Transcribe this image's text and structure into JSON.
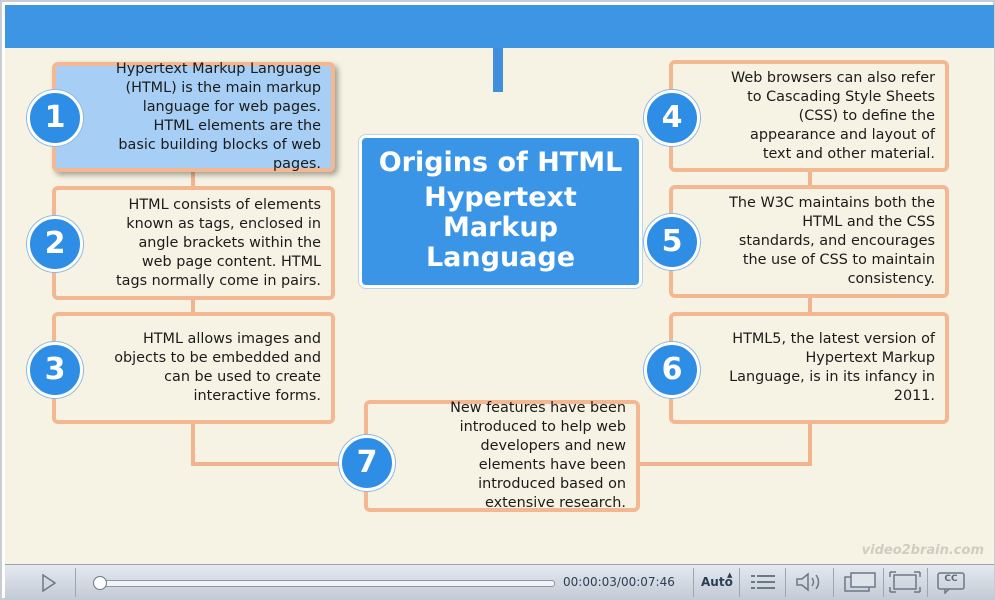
{
  "slide": {
    "center_title_line1": "Origins of HTML",
    "center_title_line2": "Hypertext\nMarkup\nLanguage",
    "watermark": "video2brain.com",
    "items": [
      {
        "number": "1",
        "text": "Hypertext Markup Language (HTML) is the main markup language for web pages. HTML elements are the basic building blocks of web pages.",
        "highlighted": true
      },
      {
        "number": "2",
        "text": "HTML consists of elements known as tags, enclosed in angle brackets within the web page content. HTML tags normally come in pairs."
      },
      {
        "number": "3",
        "text": "HTML allows images and objects to be embedded and can be used to create interactive forms."
      },
      {
        "number": "4",
        "text": "Web browsers can also refer to Cascading Style Sheets (CSS) to define the appearance and layout of text and other material."
      },
      {
        "number": "5",
        "text": "The W3C maintains both the HTML and the CSS standards, and encourages the use of CSS to maintain consistency."
      },
      {
        "number": "6",
        "text": "HTML5, the latest version of Hypertext Markup Language, is in its infancy in 2011."
      },
      {
        "number": "7",
        "text": "New features have been introduced to help web developers and new elements have been introduced based on extensive research."
      }
    ]
  },
  "player": {
    "time": "00:00:03/00:07:46",
    "quality": "Auto",
    "progress_fraction": 0.005,
    "icons": [
      "play-icon",
      "chapters-icon",
      "volume-icon",
      "window-icon",
      "fullscreen-icon",
      "closed-captions-icon"
    ],
    "cc_label": "CC"
  },
  "colors": {
    "topbar": "#3d95e4",
    "accent_blue": "#2e8ee6",
    "box_border": "#f3b892",
    "background": "#f7f3e4",
    "highlight": "#a7cff5"
  }
}
